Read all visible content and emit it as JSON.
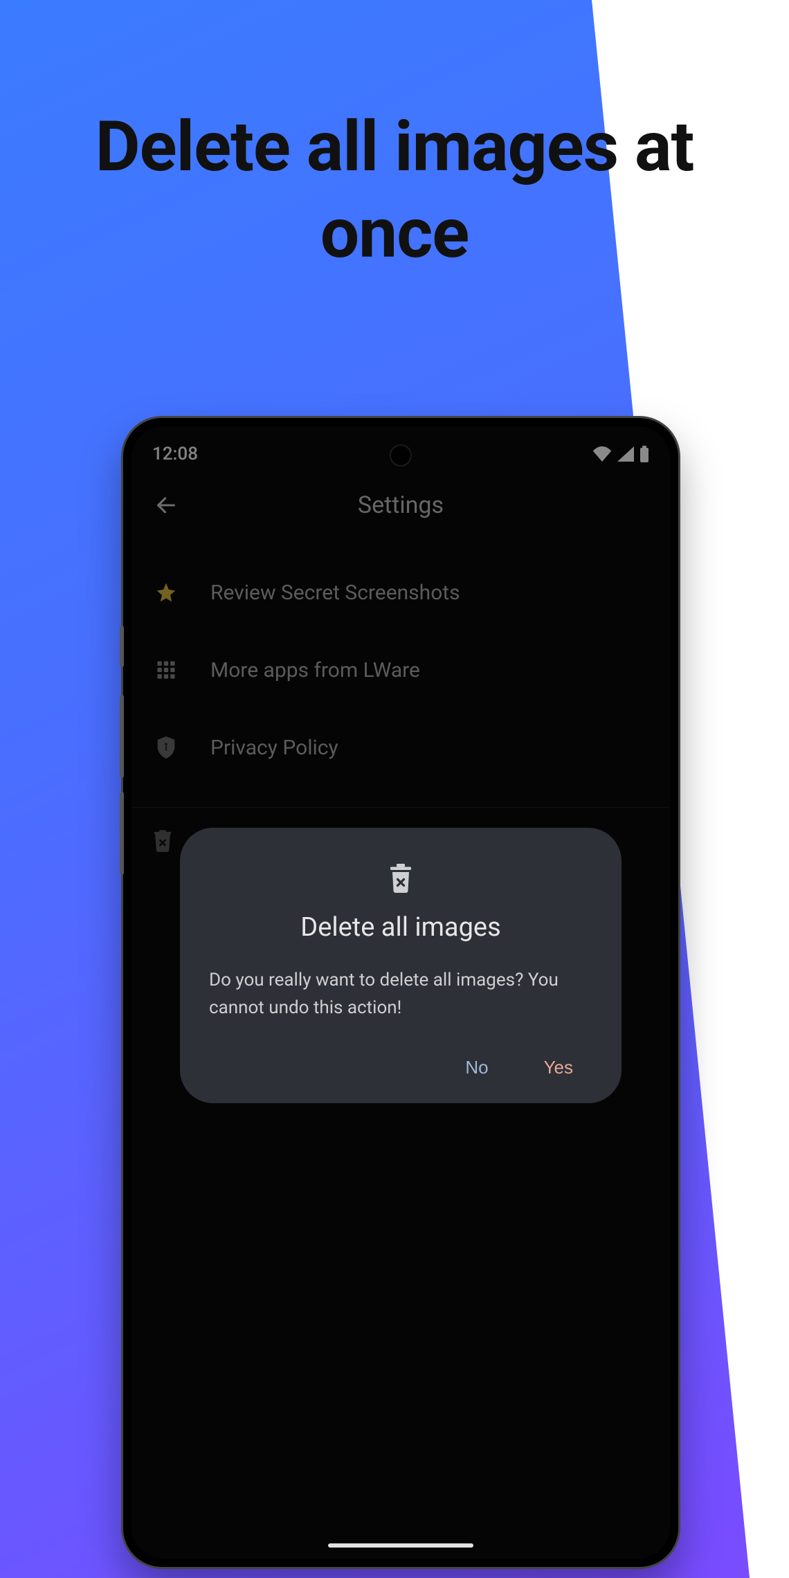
{
  "promo": {
    "headline": "Delete all images at once"
  },
  "statusbar": {
    "time": "12:08"
  },
  "header": {
    "title": "Settings"
  },
  "settings": {
    "items": [
      {
        "label": "Review Secret Screenshots"
      },
      {
        "label": "More apps from LWare"
      },
      {
        "label": "Privacy Policy"
      }
    ]
  },
  "dialog": {
    "title": "Delete all images",
    "body": "Do you really want to delete all images? You cannot undo this action!",
    "no_label": "No",
    "yes_label": "Yes"
  }
}
